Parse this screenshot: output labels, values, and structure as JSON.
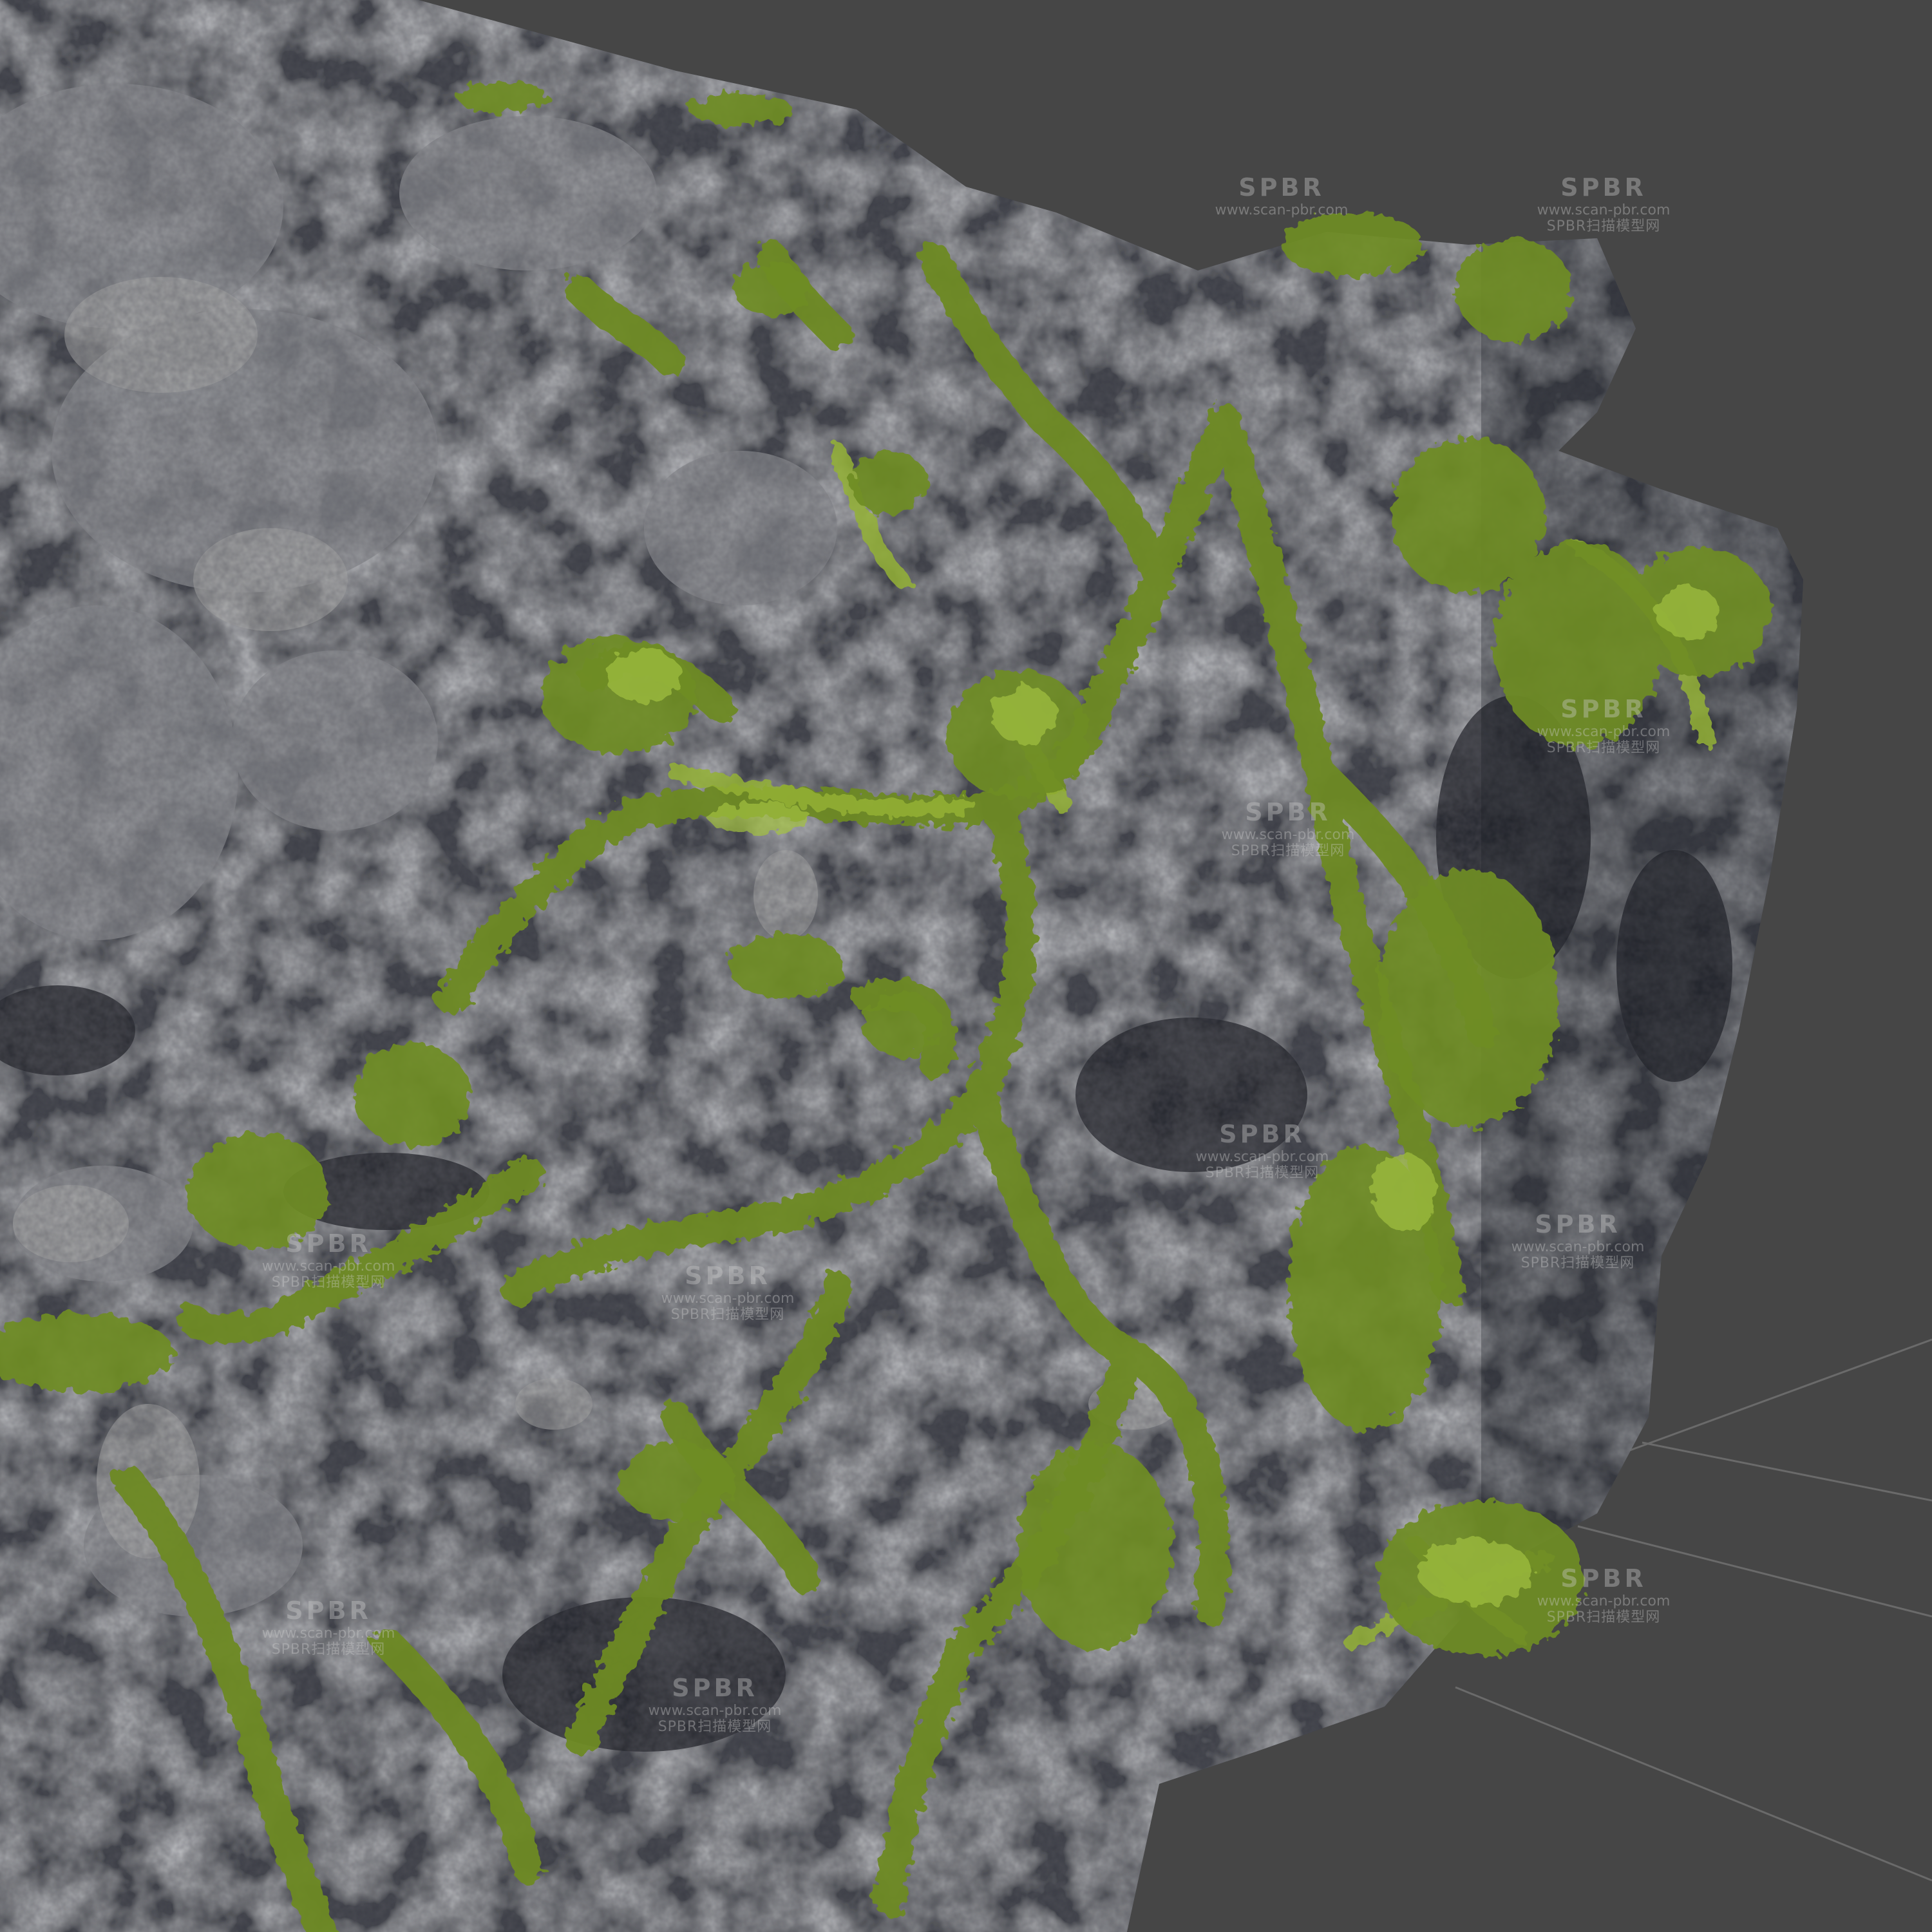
{
  "scene": {
    "background_color": "#464646",
    "grid_line_color": "#6f6f6f",
    "rock_colors": [
      "#2e3038",
      "#4a4c55",
      "#7b7d82",
      "#a9aaa8"
    ],
    "moss_colors": [
      "#5f7a1e",
      "#7e9b2a",
      "#9cb83a",
      "#4a5e17"
    ]
  },
  "watermark": {
    "logo": "SPBR",
    "url": "www.scan-pbr.com",
    "brand": "SPBR扫描模型网"
  }
}
